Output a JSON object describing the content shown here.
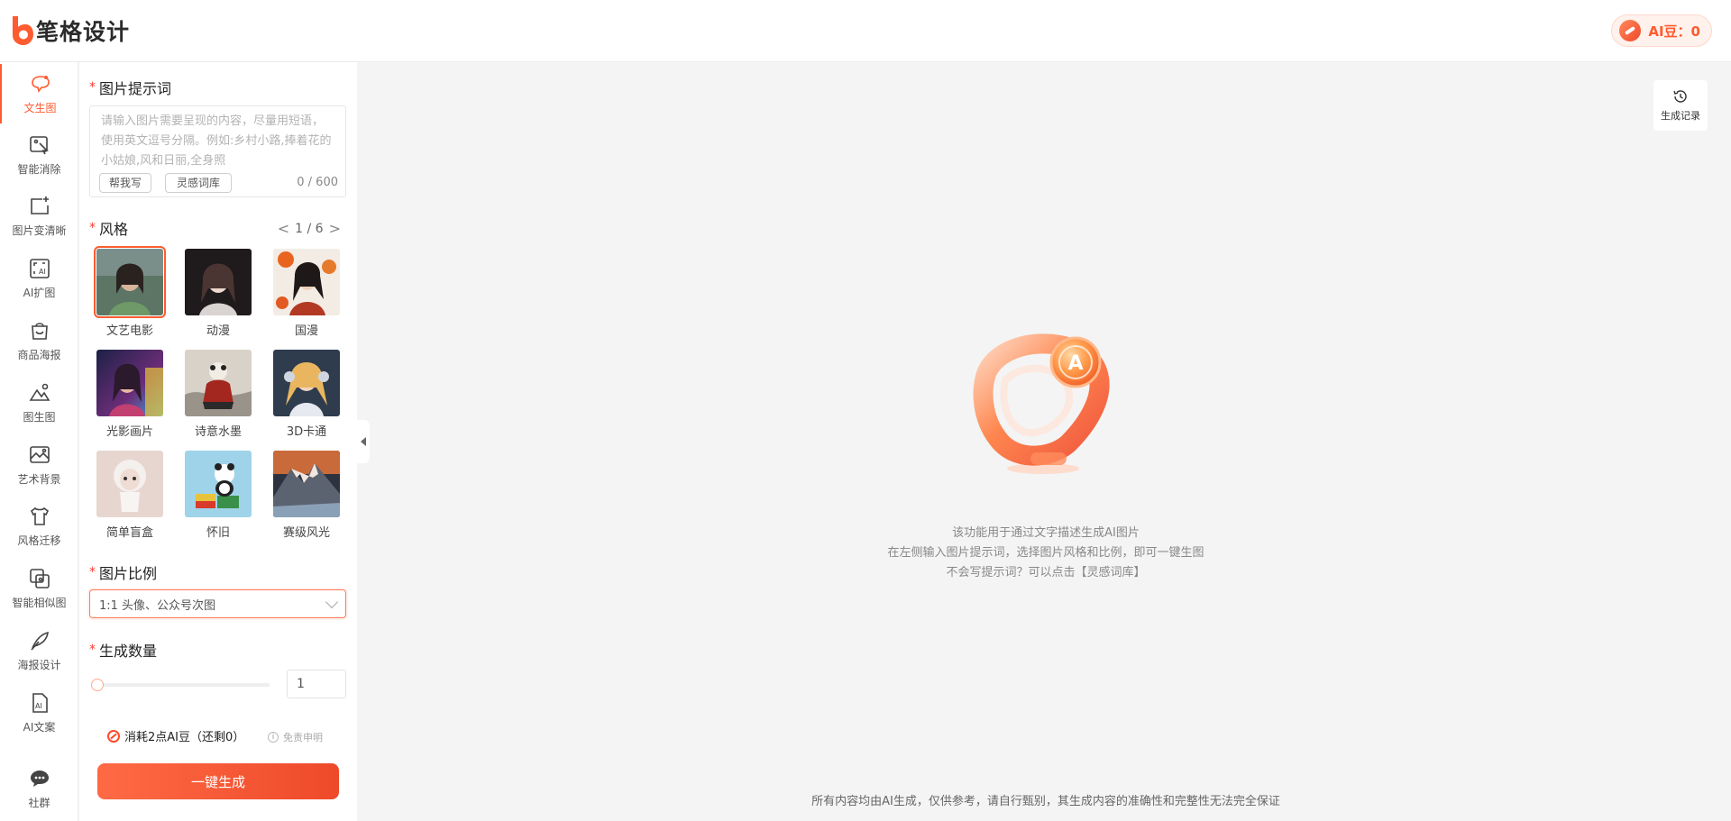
{
  "header": {
    "logo_text": "笔格设计",
    "ai_bean": "AI豆：0"
  },
  "sidenav": {
    "items": [
      {
        "label": "文生图",
        "icon": "text-to-image-icon",
        "active": true
      },
      {
        "label": "智能消除",
        "icon": "smart-erase-icon"
      },
      {
        "label": "图片变清晰",
        "icon": "image-sharpen-icon"
      },
      {
        "label": "AI扩图",
        "icon": "ai-expand-icon"
      },
      {
        "label": "商品海报",
        "icon": "product-poster-icon"
      },
      {
        "label": "图生图",
        "icon": "image-to-image-icon"
      },
      {
        "label": "艺术背景",
        "icon": "art-background-icon"
      },
      {
        "label": "风格迁移",
        "icon": "style-transfer-icon"
      },
      {
        "label": "智能相似图",
        "icon": "similar-image-icon"
      },
      {
        "label": "海报设计",
        "icon": "poster-design-icon"
      },
      {
        "label": "AI文案",
        "icon": "ai-copywriting-icon"
      },
      {
        "label": "社群",
        "icon": "community-icon"
      }
    ]
  },
  "panel": {
    "required_mark": "*",
    "prompt": {
      "title": "图片提示词",
      "placeholder": "请输入图片需要呈现的内容，尽量用短语，使用英文逗号分隔。例如:乡村小路,捧着花的小姑娘,风和日丽,全身照",
      "value": "",
      "help_write": "帮我写",
      "inspiration": "灵感词库",
      "counter": "0 / 600"
    },
    "style": {
      "title": "风格",
      "prev": "<",
      "next": ">",
      "page": "1 / 6",
      "items": [
        {
          "name": "文艺电影",
          "selected": true
        },
        {
          "name": "动漫"
        },
        {
          "name": "国漫"
        },
        {
          "name": "光影画片"
        },
        {
          "name": "诗意水墨"
        },
        {
          "name": "3D卡通"
        },
        {
          "name": "简单盲盒"
        },
        {
          "name": "怀旧"
        },
        {
          "name": "赛级风光"
        }
      ]
    },
    "ratio": {
      "title": "图片比例",
      "selected": "1:1 头像、公众号次图"
    },
    "quantity": {
      "title": "生成数量",
      "value": "1",
      "slider_fraction": 0
    },
    "cost": "消耗2点AI豆（还剩0）",
    "disclaimer": "免责申明",
    "info_glyph": "i",
    "generate": "一键生成"
  },
  "main": {
    "history": "生成记录",
    "intro": [
      "该功能用于通过文字描述生成AI图片",
      "在左侧输入图片提示词，选择图片风格和比例，即可一键生图",
      "不会写提示词？可以点击【灵感词库】"
    ],
    "hero_letter": "A",
    "footer": "所有内容均由AI生成，仅供参考，请自行甄别，其生成内容的准确性和完整性无法完全保证"
  },
  "colors": {
    "accent": "#ff5b30",
    "accent_dark": "#ee4a2a"
  }
}
